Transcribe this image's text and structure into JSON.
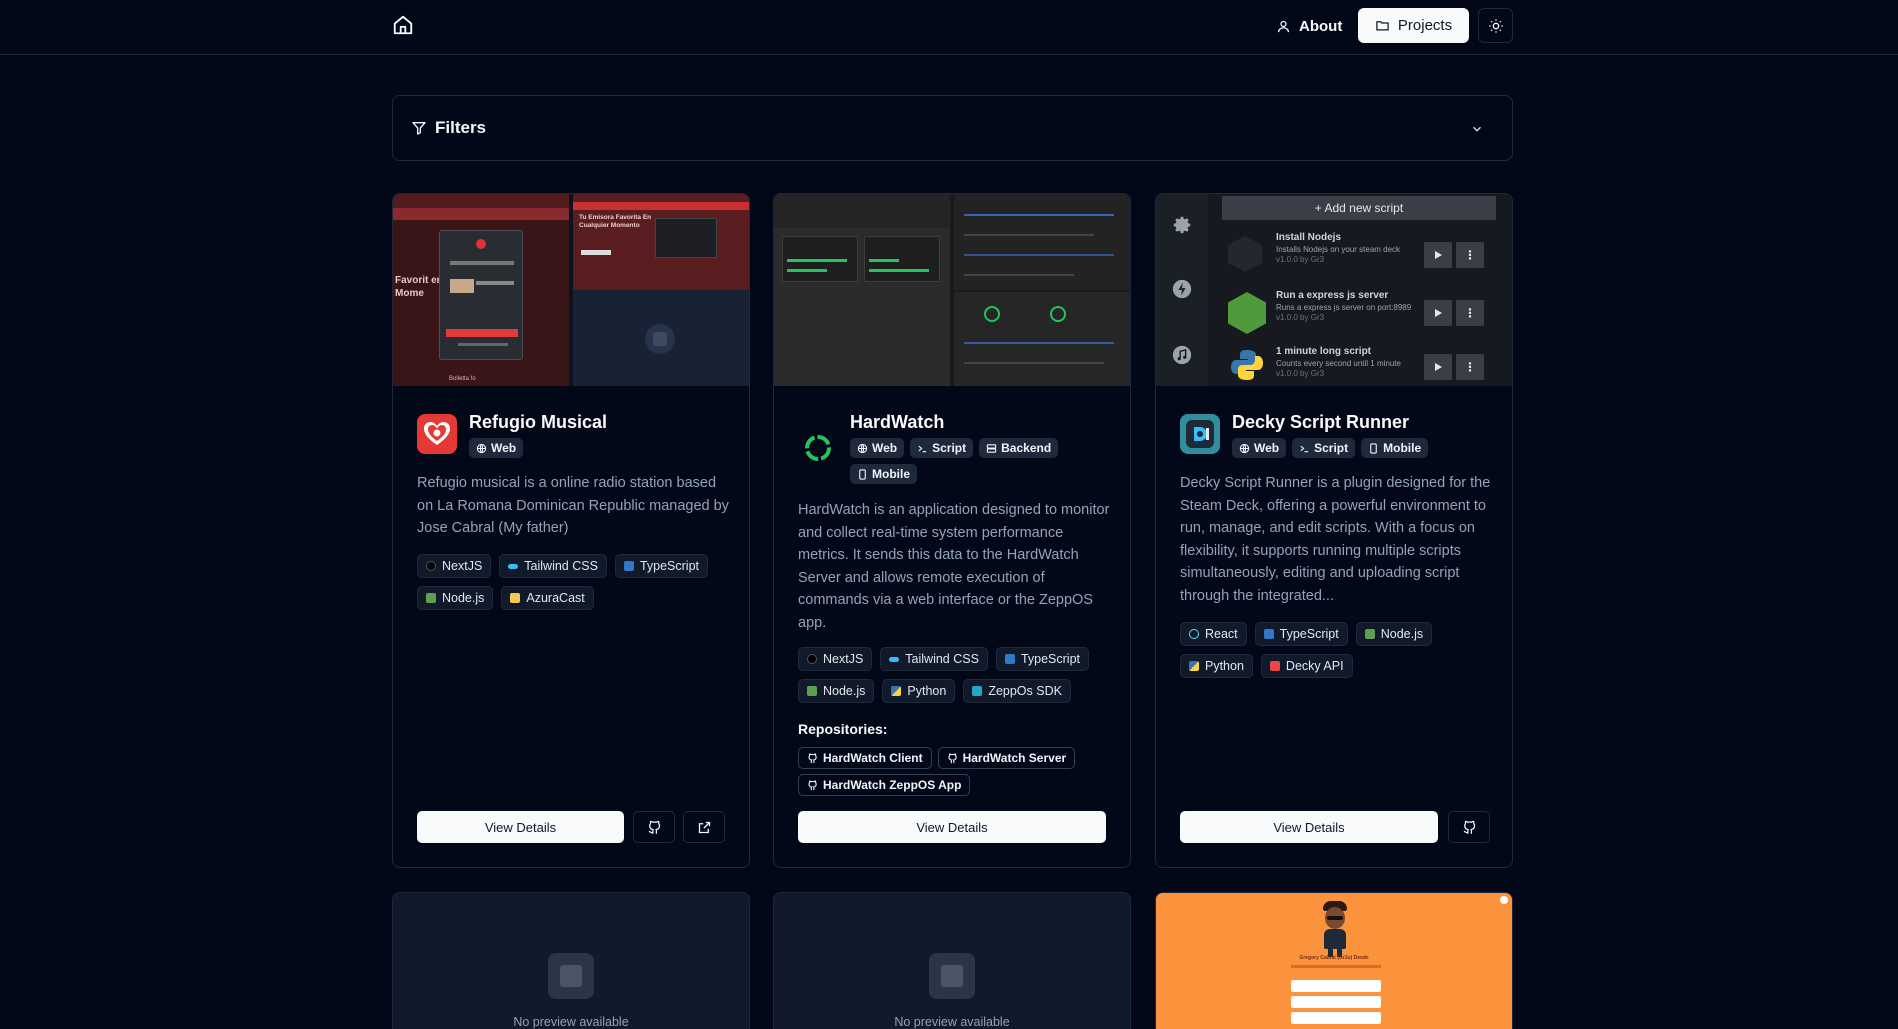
{
  "nav": {
    "about_label": "About",
    "projects_label": "Projects",
    "icons": [
      "home-icon",
      "user-icon",
      "folder-icon",
      "sun-icon"
    ]
  },
  "filters": {
    "label": "Filters",
    "icons": [
      "filter-icon",
      "chevron-down-icon"
    ]
  },
  "projects": [
    {
      "title": "Refugio Musical",
      "categories": [
        "Web"
      ],
      "description": "Refugio musical is a online radio station based on La Romana Dominican Republic managed by Jose Cabral (My father)",
      "technologies": [
        "NextJS",
        "Tailwind CSS",
        "TypeScript",
        "Node.js",
        "AzuraCast"
      ],
      "details_label": "View Details",
      "preview_text": {
        "hero_left": "Favorit er Mome",
        "hero_right": "Tu Emisora Favorita En Cualquier Momento",
        "footer": "Bolletta fo"
      }
    },
    {
      "title": "HardWatch",
      "categories": [
        "Web",
        "Script",
        "Backend",
        "Mobile"
      ],
      "description": "HardWatch is an application designed to monitor and collect real-time system performance metrics. It sends this data to the HardWatch Server and allows remote execution of commands via a web interface or the ZeppOS app.",
      "technologies": [
        "NextJS",
        "Tailwind CSS",
        "TypeScript",
        "Node.js",
        "Python",
        "ZeppOs SDK"
      ],
      "repositories_label": "Repositories:",
      "repositories": [
        "HardWatch Client",
        "HardWatch Server",
        "HardWatch ZeppOS App"
      ],
      "details_label": "View Details"
    },
    {
      "title": "Decky Script Runner",
      "categories": [
        "Web",
        "Script",
        "Mobile"
      ],
      "description": "Decky Script Runner is a plugin designed for the Steam Deck, offering a powerful environment to run, manage, and edit scripts. With a focus on flexibility, it supports running multiple scripts simultaneously, editing and uploading script through the integrated...",
      "technologies": [
        "React",
        "TypeScript",
        "Node.js",
        "Python",
        "Decky API"
      ],
      "details_label": "View Details",
      "preview": {
        "add_label": "+ Add new script",
        "scripts": [
          {
            "name": "Install Nodejs",
            "sub": "Installs Nodejs on your steam deck",
            "ver": "v1.0.0 by Gr3"
          },
          {
            "name": "Run a express js server",
            "sub": "Runs a express js server on port:8989",
            "ver": "v1.0.0 by Gr3"
          },
          {
            "name": "1 minute long script",
            "sub": "Counts every second until 1 minute",
            "ver": "v1.0.0 by Gr3"
          }
        ]
      }
    }
  ],
  "bottom_cards": [
    {
      "no_preview": "No preview available"
    },
    {
      "no_preview": "No preview available"
    },
    {
      "title": "Gregory Cabral (Gr3u) Desde"
    }
  ],
  "colors": {
    "background": "#020817",
    "border": "#1e293b",
    "muted_text": "#94a3b8",
    "button_light": "#f8fafc",
    "accent_orange": "#fb923c"
  }
}
